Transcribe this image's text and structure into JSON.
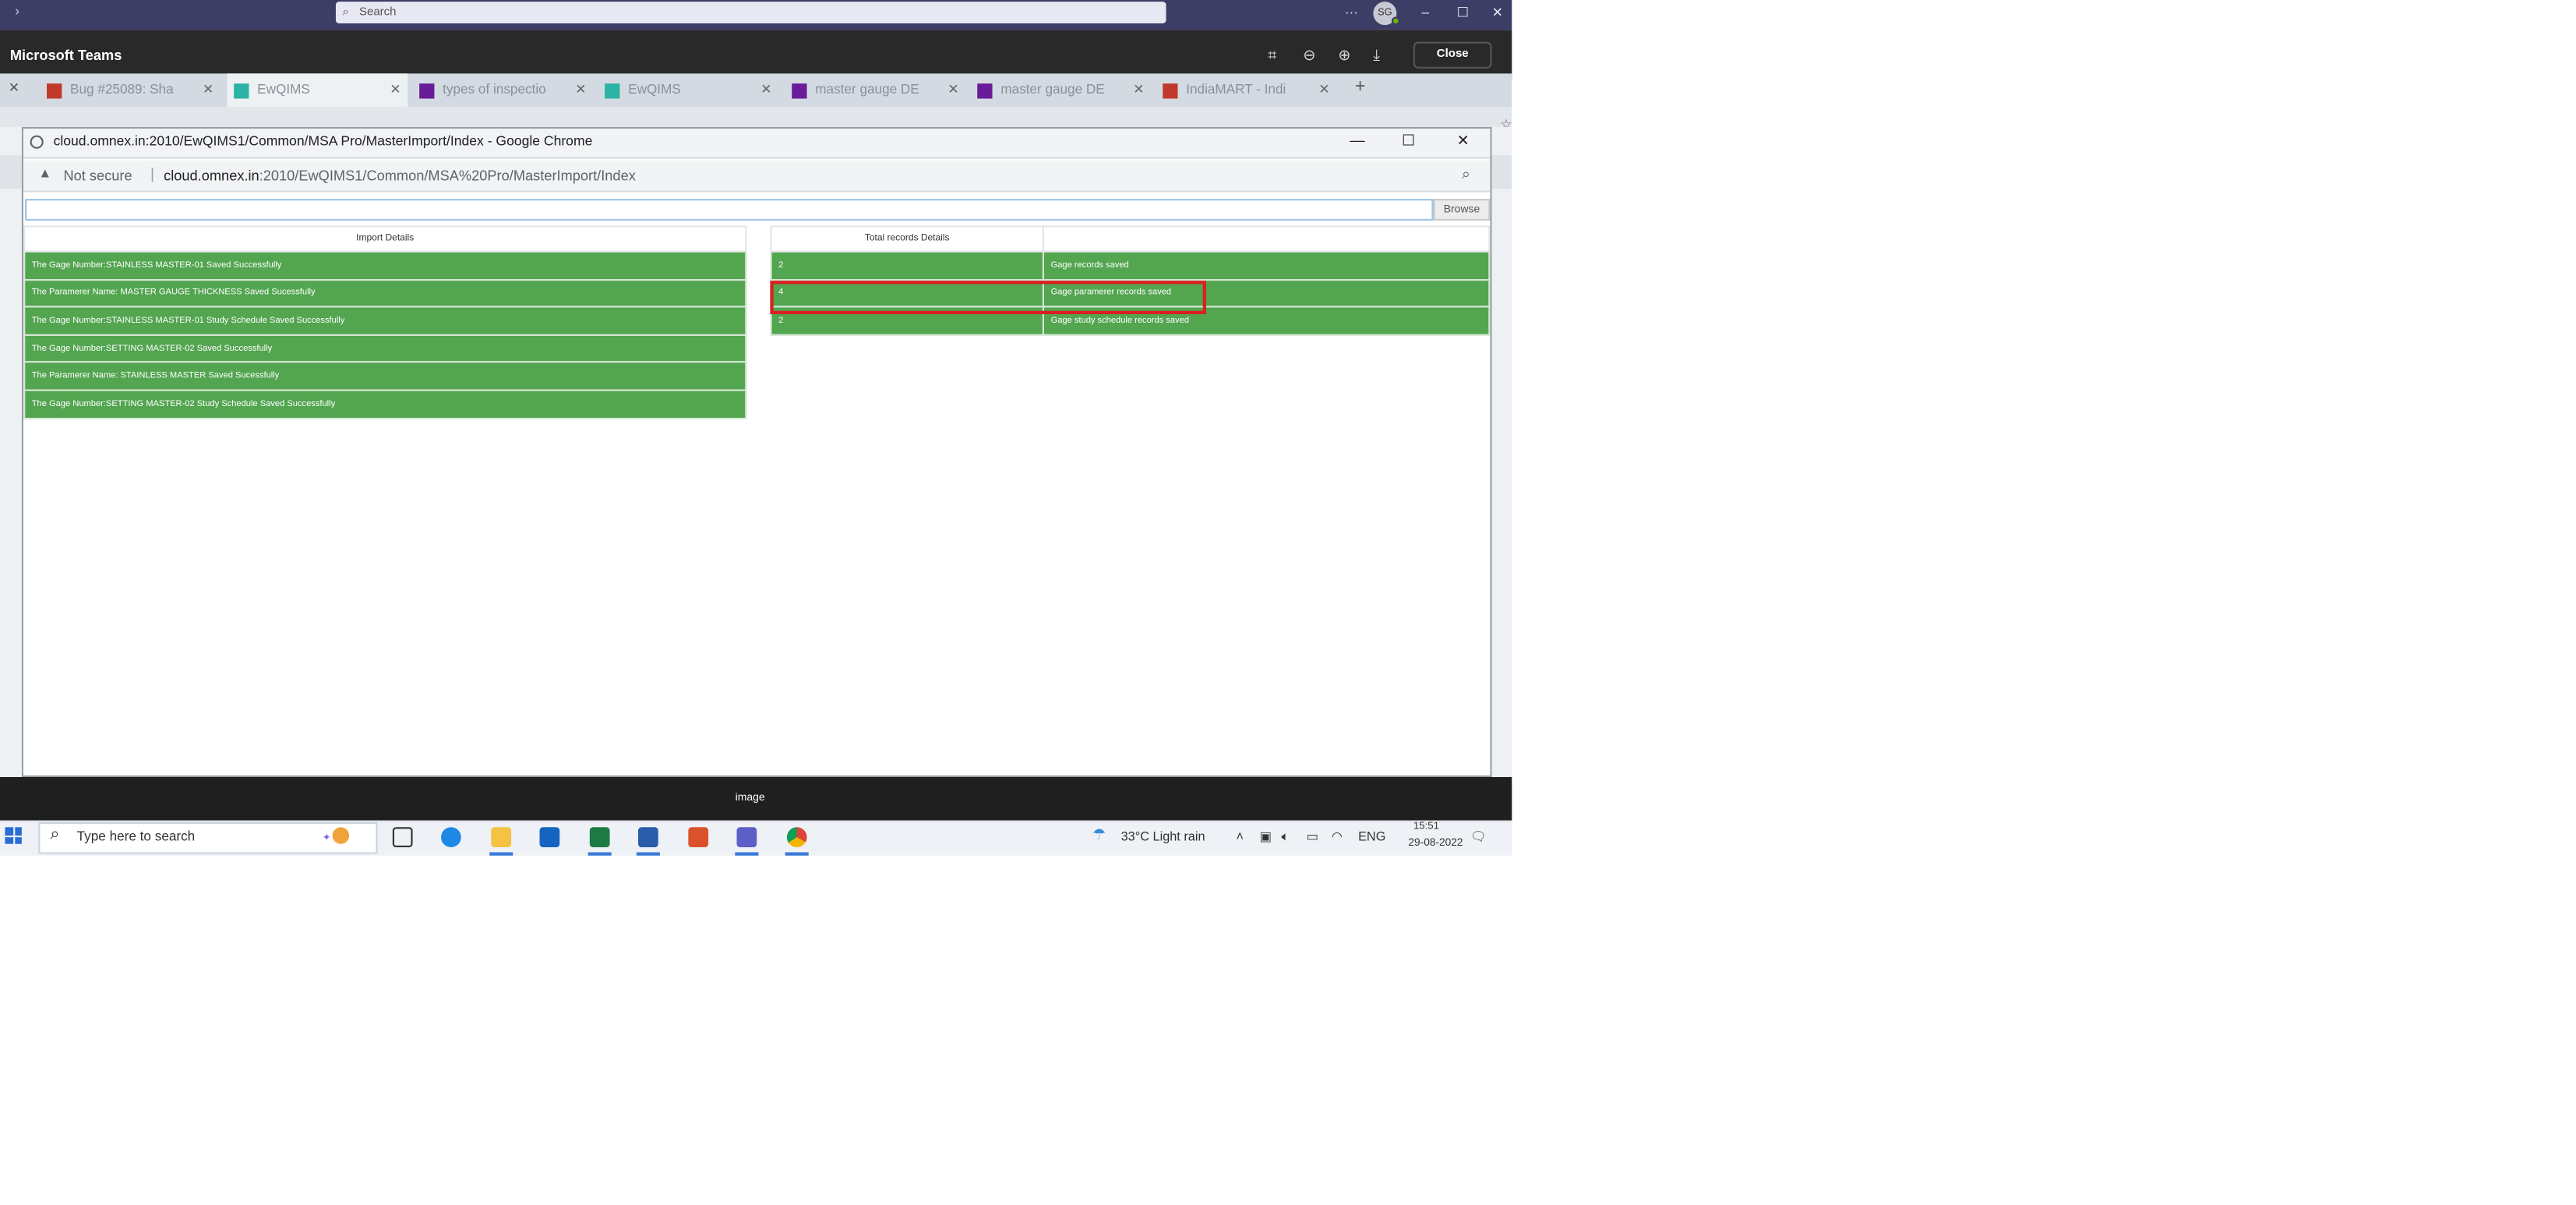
{
  "teams": {
    "search_placeholder": "Search",
    "avatar_initials": "SG",
    "viewer_title": "Microsoft Teams",
    "close_label": "Close",
    "caption": "image"
  },
  "browser_tabs": [
    {
      "label": "Bug #25089: Sha",
      "icon_color": "#c0392b"
    },
    {
      "label": "EwQIMS",
      "icon_color": "#2bb3a4"
    },
    {
      "label": "types of inspectio",
      "icon_color": "#6a1b9a"
    },
    {
      "label": "EwQIMS",
      "icon_color": "#2bb3a4"
    },
    {
      "label": "master gauge DE",
      "icon_color": "#6a1b9a"
    },
    {
      "label": "master gauge DE",
      "icon_color": "#6a1b9a"
    },
    {
      "label": "IndiaMART - Indi",
      "icon_color": "#c0392b"
    }
  ],
  "popup": {
    "window_title": "cloud.omnex.in:2010/EwQIMS1/Common/MSA Pro/MasterImport/Index - Google Chrome",
    "not_secure": "Not secure",
    "url_host": "cloud.omnex.in",
    "url_path": ":2010/EwQIMS1/Common/MSA%20Pro/MasterImport/Index",
    "browse_label": "Browse"
  },
  "import_details": {
    "header": "Import Details",
    "rows": [
      "The Gage Number:STAINLESS MASTER-01 Saved Successfully",
      "The Paramerer Name: MASTER GAUGE THICKNESS Saved Sucessfully",
      "The Gage Number:STAINLESS MASTER-01 Study Schedule Saved Successfully",
      "The Gage Number:SETTING MASTER-02 Saved Successfully",
      "The Paramerer Name: STAINLESS MASTER Saved Sucessfully",
      "The Gage Number:SETTING MASTER-02 Study Schedule Saved Successfully"
    ]
  },
  "totals": {
    "header": "Total records Details",
    "rows": [
      {
        "count": "2",
        "label": "Gage records saved"
      },
      {
        "count": "4",
        "label": "Gage paramerer records saved"
      },
      {
        "count": "2",
        "label": "Gage study schedule records saved"
      }
    ]
  },
  "taskbar": {
    "search_placeholder": "Type here to search",
    "weather": "33°C  Light rain",
    "language": "ENG",
    "time": "15:51",
    "date": "29-08-2022"
  },
  "colors": {
    "success_green": "#53a550",
    "highlight_red": "#d92020",
    "teams_purple": "#3d3e66"
  }
}
